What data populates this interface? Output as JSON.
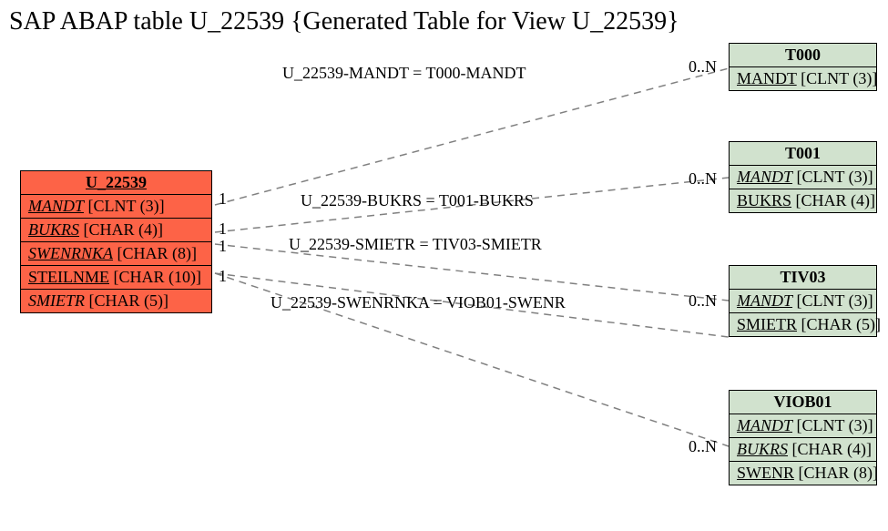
{
  "title": "SAP ABAP table U_22539 {Generated Table for View U_22539}",
  "entity_main": {
    "name": "U_22539",
    "fields": [
      {
        "name": "MANDT",
        "type": "[CLNT (3)]",
        "underline": true,
        "italic": true
      },
      {
        "name": "BUKRS",
        "type": "[CHAR (4)]",
        "underline": true,
        "italic": true
      },
      {
        "name": "SWENRNKA",
        "type": "[CHAR (8)]",
        "underline": true,
        "italic": true
      },
      {
        "name": "STEILNME",
        "type": "[CHAR (10)]",
        "underline": true,
        "italic": false
      },
      {
        "name": "SMIETR",
        "type": "[CHAR (5)]",
        "underline": false,
        "italic": true
      }
    ]
  },
  "entity_t000": {
    "name": "T000",
    "fields": [
      {
        "name": "MANDT",
        "type": "[CLNT (3)]",
        "underline": true,
        "italic": false
      }
    ]
  },
  "entity_t001": {
    "name": "T001",
    "fields": [
      {
        "name": "MANDT",
        "type": "[CLNT (3)]",
        "underline": true,
        "italic": true
      },
      {
        "name": "BUKRS",
        "type": "[CHAR (4)]",
        "underline": true,
        "italic": false
      }
    ]
  },
  "entity_tiv03": {
    "name": "TIV03",
    "fields": [
      {
        "name": "MANDT",
        "type": "[CLNT (3)]",
        "underline": true,
        "italic": true
      },
      {
        "name": "SMIETR",
        "type": "[CHAR (5)]",
        "underline": true,
        "italic": false
      }
    ]
  },
  "entity_viob01": {
    "name": "VIOB01",
    "fields": [
      {
        "name": "MANDT",
        "type": "[CLNT (3)]",
        "underline": true,
        "italic": true
      },
      {
        "name": "BUKRS",
        "type": "[CHAR (4)]",
        "underline": true,
        "italic": true
      },
      {
        "name": "SWENR",
        "type": "[CHAR (8)]",
        "underline": true,
        "italic": false
      }
    ]
  },
  "relations": {
    "r1": {
      "label": "U_22539-MANDT = T000-MANDT",
      "left": "1",
      "right": "0..N"
    },
    "r2": {
      "label": "U_22539-BUKRS = T001-BUKRS",
      "left": "1",
      "right": "0..N"
    },
    "r3": {
      "label": "U_22539-SMIETR = TIV03-SMIETR",
      "left": "1",
      "right": ""
    },
    "r4": {
      "label": "U_22539-SWENRNKA = VIOB01-SWENR",
      "left": "1",
      "right": "0..N"
    },
    "r5_right": "0..N"
  }
}
